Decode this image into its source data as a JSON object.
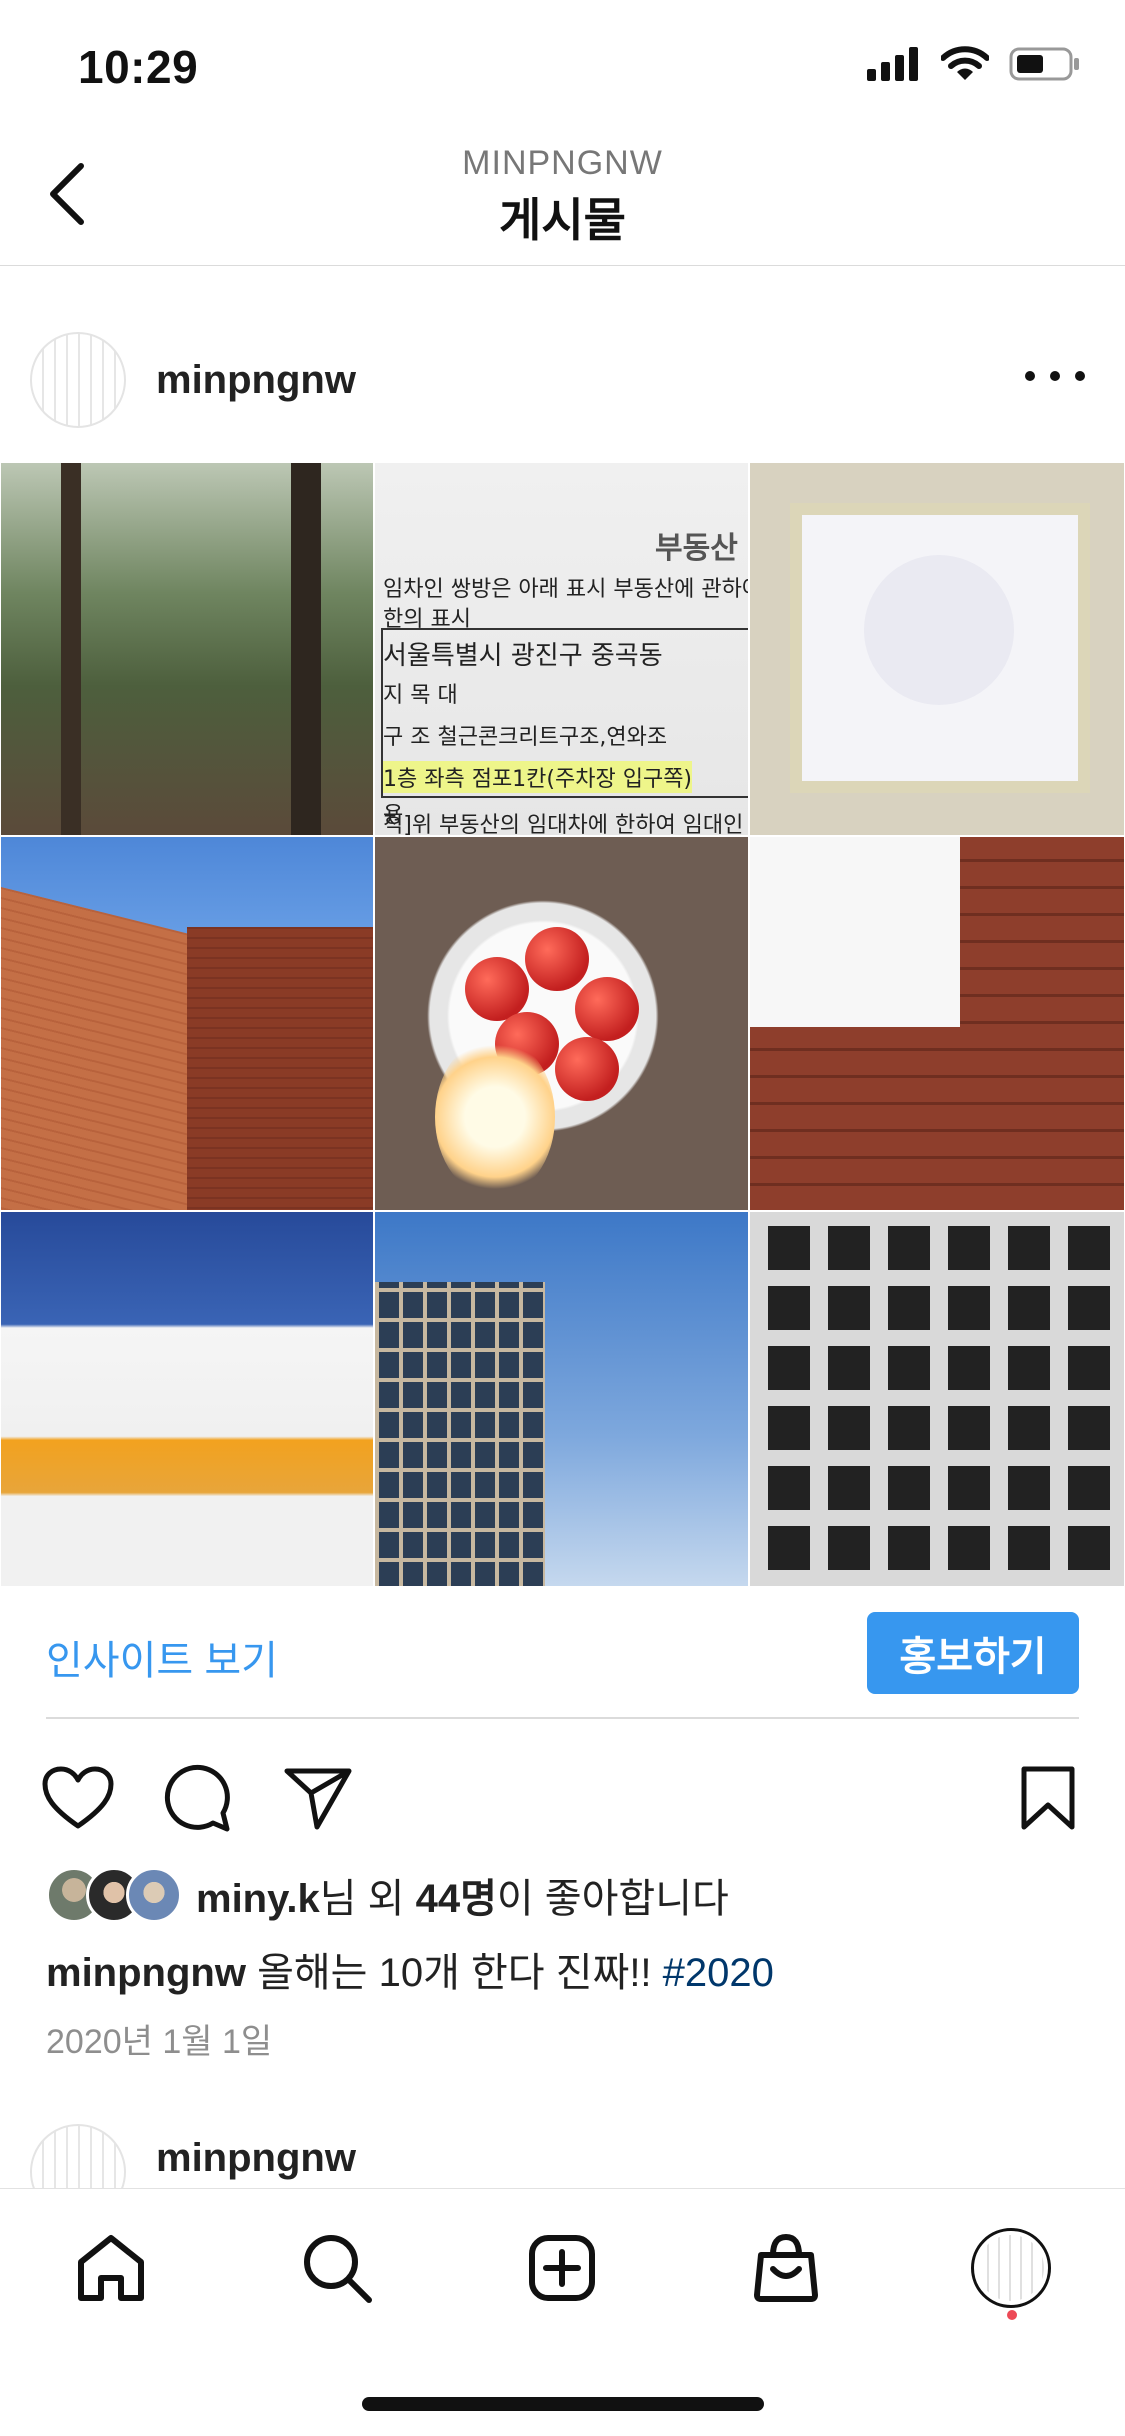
{
  "status_bar": {
    "time": "10:29"
  },
  "header": {
    "account": "MINPNGNW",
    "title": "게시물"
  },
  "post": {
    "username": "minpngnw",
    "grid_images": [
      "forest-photo",
      "lease-document-photo",
      "framed-manual-photo",
      "brick-building-photo",
      "strawberry-cake-photo",
      "brick-table-photo",
      "sculpture-photo",
      "office-building-photo",
      "shadow-grid-photo"
    ],
    "doc_lines": [
      "부동산",
      "임차인 쌍방은 아래 표시 부동산에 관하여",
      "한의 표시",
      "서울특별시 광진구 중곡동",
      "지  목   대",
      "구  조  철근콘크리트구조,연와조",
      "1층 좌측 점포1칸(주차장 입구쪽)",
      "용",
      "적]위 부동산의 임대차에 한하여 임대인"
    ],
    "insight_label": "인사이트 보기",
    "promote_label": "홍보하기",
    "likes": {
      "user": "miny.k",
      "middle": "님 외 ",
      "count": "44명",
      "suffix": "이 좋아합니다"
    },
    "caption": {
      "user": "minpngnw",
      "text": " 올해는 10개 한다 진짜!! ",
      "hashtag": "#2020"
    },
    "date": "2020년 1월 1일"
  },
  "next_post": {
    "username": "minpngnw"
  },
  "tab_bar": [
    "home-icon",
    "search-icon",
    "new-post-icon",
    "shop-icon",
    "profile-avatar"
  ]
}
